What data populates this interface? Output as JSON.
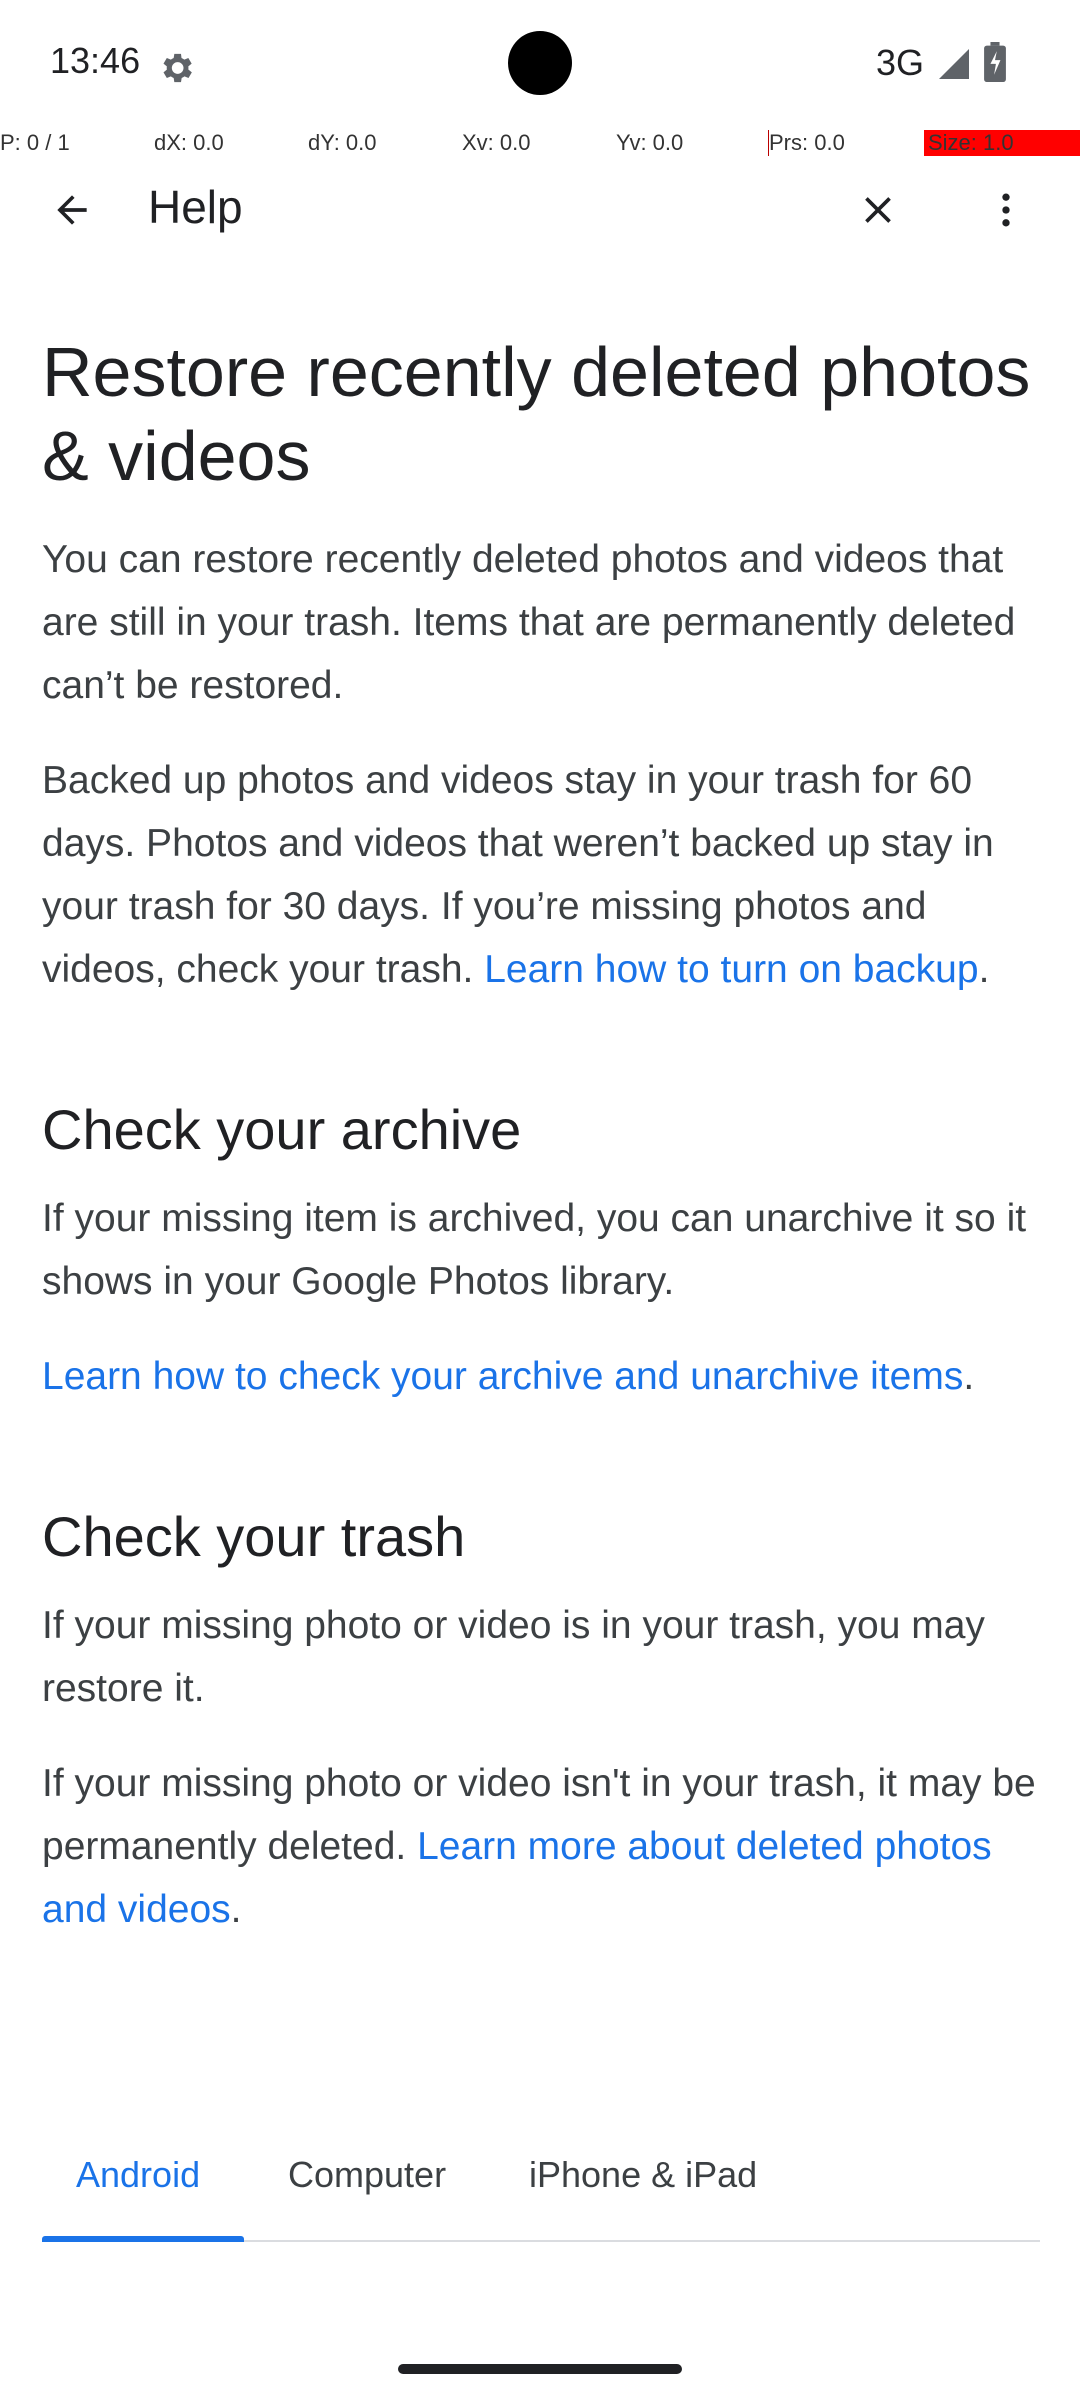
{
  "status_bar": {
    "time": "13:46",
    "network": "3G",
    "icons": [
      "settings-gear-icon",
      "signal-icon",
      "battery-icon"
    ]
  },
  "debug_overlay": {
    "pointer": "P: 0 / 1",
    "dx": "dX: 0.0",
    "dy": "dY: 0.0",
    "xv": "Xv: 0.0",
    "yv": "Yv: 0.0",
    "prs": "Prs: 0.0",
    "size": "Size: 1.0"
  },
  "app_bar": {
    "title": "Help",
    "icons": [
      "back-arrow-icon",
      "close-icon",
      "more-vert-icon"
    ]
  },
  "article": {
    "title": "Restore recently deleted photos & videos",
    "intro": "You can restore recently deleted photos and videos that are still in your trash. Items that are permanently deleted can’t be restored.",
    "backup_text": "Backed up photos and videos stay in your trash for 60 days. Photos and videos that weren’t backed up stay in your trash for 30 days. If you’re missing photos and videos, check your trash.",
    "backup_link": "Learn how to turn on backup",
    "period": ".",
    "archive_heading": "Check your archive",
    "archive_text": "If your missing item is archived, you can unarchive it so it shows in your Google Photos library.",
    "archive_link": "Learn how to check your archive and unarchive items",
    "trash_heading": "Check your trash",
    "trash_text1": "If your missing photo or video is in your trash, you may restore it.",
    "trash_text2": "If your missing photo or video isn't in your trash, it may be permanently deleted.",
    "trash_link": "Learn more about deleted photos and videos"
  },
  "tabs": [
    {
      "label": "Android",
      "active": true
    },
    {
      "label": "Computer",
      "active": false
    },
    {
      "label": "iPhone & iPad",
      "active": false
    }
  ],
  "colors": {
    "link": "#1a73e8",
    "text": "#3c4043",
    "heading": "#202124"
  }
}
